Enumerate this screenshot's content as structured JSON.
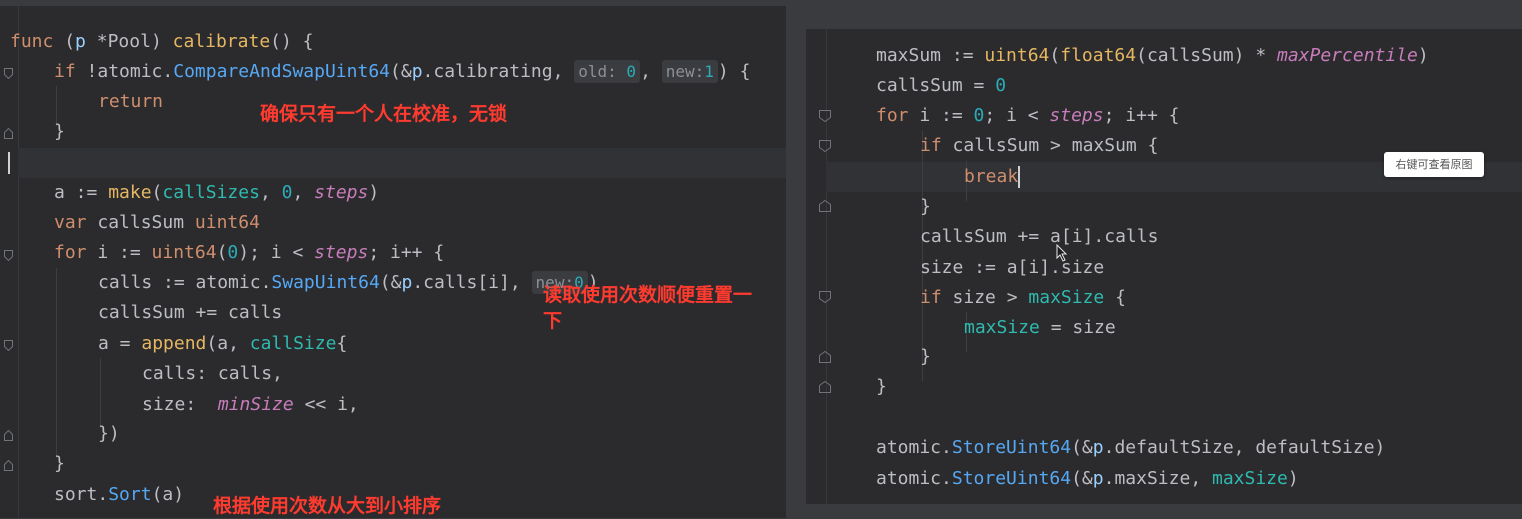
{
  "left": {
    "l1": {
      "kw": "func",
      "open": "(",
      "recv": "p",
      "star": " *",
      "type": "Pool",
      "close": ")",
      "name": "calibrate",
      "rest": "() {"
    },
    "l2": {
      "kw": "if",
      "not": "!",
      "pkg": "atomic",
      "dot": ".",
      "fn": "CompareAndSwapUint64",
      "open": "(&",
      "recv": "p",
      "field": ".calibrating, ",
      "hint_old": "old:",
      "zero": "0",
      "comma": ", ",
      "hint_new": "new:",
      "one": "1",
      "close": ") {"
    },
    "l3": {
      "kw": "return"
    },
    "l4": {
      "text": "}"
    },
    "l6": {
      "a": "a := ",
      "fn": "make",
      "open": "(",
      "type": "callSizes",
      "mid": ", ",
      "zero": "0",
      "comma": ", ",
      "steps": "steps",
      "close": ")"
    },
    "l7": {
      "kw": "var",
      "name": " callsSum ",
      "type": "uint64"
    },
    "l8": {
      "kw": "for",
      "a": " i := ",
      "type": "uint64",
      "open": "(",
      "zero": "0",
      "b": "); i < ",
      "steps": "steps",
      "c": "; i++ {"
    },
    "l9": {
      "a": "calls := ",
      "pkg": "atomic",
      "dot": ".",
      "fn": "SwapUint64",
      "open": "(&",
      "recv": "p",
      "field": ".calls[i], ",
      "hint_new": "new:",
      "zero": "0",
      "close": ")"
    },
    "l10": {
      "text": "callsSum += calls"
    },
    "l11": {
      "a": "a = ",
      "fn": "append",
      "open": "(a, ",
      "type": "callSize",
      "close": "{"
    },
    "l12": {
      "key": "calls",
      "rest": ": calls,"
    },
    "l13": {
      "key": "size",
      "colon": ":  ",
      "var": "minSize",
      "rest": " << i,"
    },
    "l14": {
      "text": "})"
    },
    "l15": {
      "text": "}"
    },
    "l16": {
      "pkg": "sort",
      "dot": ".",
      "fn": "Sort",
      "rest": "(a)"
    }
  },
  "right": {
    "r1": {
      "a": "maxSum := ",
      "t1": "uint64",
      "o1": "(",
      "t2": "float64",
      "o2": "(callsSum) * ",
      "var": "maxPercentile",
      "c": ")"
    },
    "r2": {
      "a": "callsSum = ",
      "zero": "0"
    },
    "r3": {
      "kw": "for",
      "a": " i := ",
      "zero": "0",
      "b": "; i < ",
      "steps": "steps",
      "c": "; i++ {"
    },
    "r4": {
      "kw": "if",
      "rest": " callsSum > maxSum {"
    },
    "r5": {
      "kw": "break"
    },
    "r6": {
      "text": "}"
    },
    "r7": {
      "text": "callsSum += a[i].calls"
    },
    "r8": {
      "text": "size := a[i].size"
    },
    "r9": {
      "kw": "if",
      "rest": " size > ",
      "teal": "maxSize",
      "end": " {"
    },
    "r10": {
      "teal": "maxSize",
      "rest": " = size"
    },
    "r11": {
      "text": "}"
    },
    "r12": {
      "text": "}"
    },
    "r14": {
      "pkg": "atomic",
      "dot": ".",
      "fn": "StoreUint64",
      "open": "(&",
      "recv": "p",
      "rest": ".defaultSize, defaultSize)"
    },
    "r15": {
      "pkg": "atomic",
      "dot": ".",
      "fn": "StoreUint64",
      "open": "(&",
      "recv": "p",
      "rest": ".maxSize, ",
      "teal": "maxSize",
      "close": ")"
    }
  },
  "annotations": {
    "lock": "确保只有一个人在校准，无锁",
    "reset_line1": "读取使用次数顺便重置一",
    "reset_line2": "下",
    "sort": "根据使用次数从大到小排序"
  },
  "tooltip": "右键可查看原图",
  "colors": {
    "keyword": "#cf8e6d",
    "function": "#56a8f5",
    "number": "#2aacb8",
    "type": "#2fbab0",
    "annotation": "#ff3b2f",
    "background": "#2b2b2d"
  }
}
